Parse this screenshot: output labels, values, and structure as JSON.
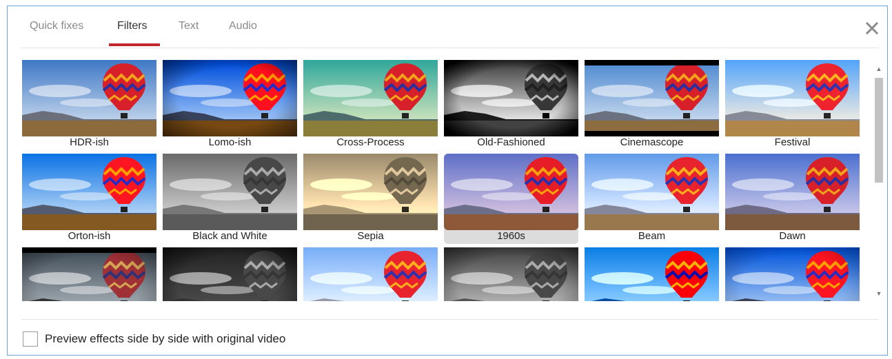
{
  "tabs": [
    {
      "label": "Quick fixes"
    },
    {
      "label": "Filters",
      "active": true
    },
    {
      "label": "Text"
    },
    {
      "label": "Audio"
    }
  ],
  "close_icon": "close-icon",
  "filters": [
    {
      "label": "HDR-ish",
      "style": "hdr"
    },
    {
      "label": "Lomo-ish",
      "style": "lomo"
    },
    {
      "label": "Cross-Process",
      "style": "cross"
    },
    {
      "label": "Old-Fashioned",
      "style": "oldbw"
    },
    {
      "label": "Cinemascope",
      "style": "cinema"
    },
    {
      "label": "Festival",
      "style": "festival"
    },
    {
      "label": "Orton-ish",
      "style": "orton"
    },
    {
      "label": "Black and White",
      "style": "bw"
    },
    {
      "label": "Sepia",
      "style": "sepia"
    },
    {
      "label": "1960s",
      "style": "sixties",
      "selected": true
    },
    {
      "label": "Beam",
      "style": "beam"
    },
    {
      "label": "Dawn",
      "style": "dawn"
    },
    {
      "label": "",
      "style": "dark"
    },
    {
      "label": "",
      "style": "darkbw"
    },
    {
      "label": "",
      "style": "bright"
    },
    {
      "label": "",
      "style": "bw2"
    },
    {
      "label": "",
      "style": "poster"
    },
    {
      "label": "",
      "style": "lomo2"
    }
  ],
  "preview_checkbox": {
    "label": "Preview effects side by side with original video",
    "checked": false
  },
  "colors": {
    "accent": "#c0272d"
  }
}
